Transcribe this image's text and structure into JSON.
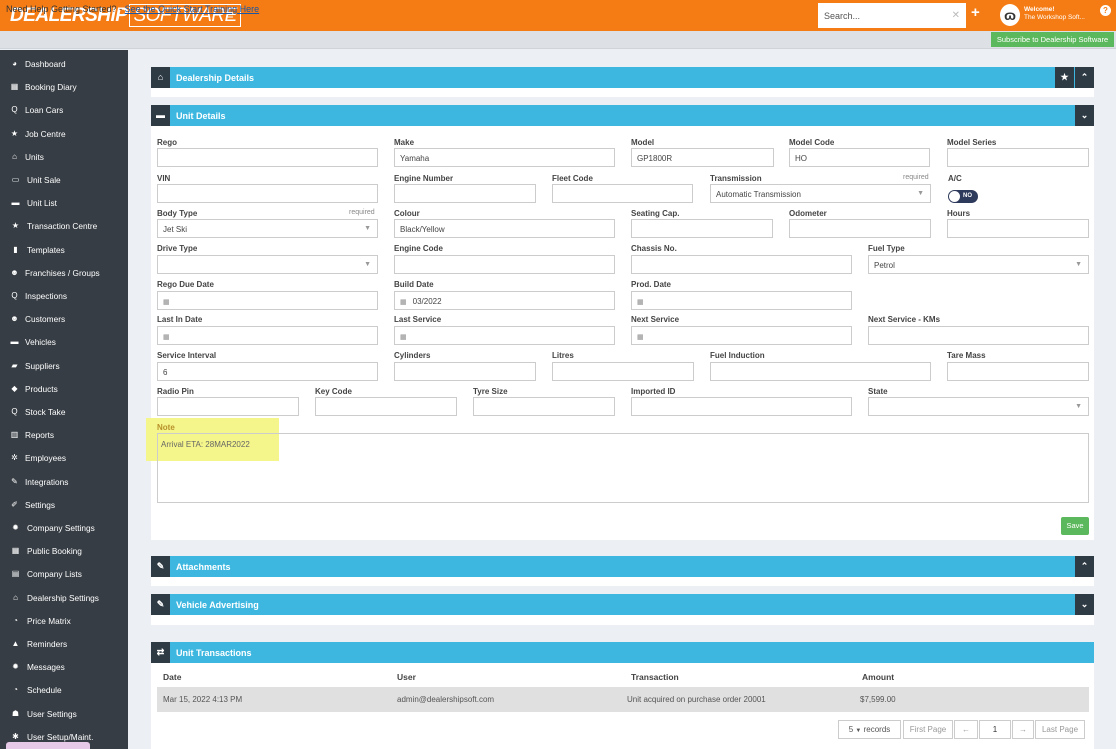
{
  "brand": {
    "bold": "DEALERSHIP",
    "light": "SOFTWARE"
  },
  "header": {
    "menu_icon": "hamburger-icon",
    "search_placeholder": "Search...",
    "welcome_title": "Welcome!",
    "welcome_user": "The Workshop Soft..."
  },
  "helpbar": {
    "text": "Need Help Getting Started? - ",
    "link": "See the Quick Start Training Here",
    "subscribe": "Subscribe to Dealership Software"
  },
  "sidebar": {
    "items": [
      {
        "label": "Dashboard",
        "icon": "dashboard-icon",
        "glyph": "◕"
      },
      {
        "label": "Booking Diary",
        "icon": "calendar-icon",
        "glyph": "▦"
      },
      {
        "label": "Loan Cars",
        "icon": "search-icon",
        "glyph": "Q"
      },
      {
        "label": "Job Centre",
        "icon": "star-icon",
        "glyph": "★"
      },
      {
        "label": "Units",
        "icon": "bank-icon",
        "glyph": "⌂"
      },
      {
        "label": "Unit Sale",
        "icon": "card-icon",
        "glyph": "▭"
      },
      {
        "label": "Unit List",
        "icon": "car-icon",
        "glyph": "▬"
      },
      {
        "label": "Transaction Centre",
        "icon": "star-icon",
        "glyph": "★"
      },
      {
        "label": "Templates",
        "icon": "file-icon",
        "glyph": "▮"
      },
      {
        "label": "Franchises / Groups",
        "icon": "users-icon",
        "glyph": "☻"
      },
      {
        "label": "Inspections",
        "icon": "search-icon",
        "glyph": "Q"
      },
      {
        "label": "Customers",
        "icon": "users-icon",
        "glyph": "☻"
      },
      {
        "label": "Vehicles",
        "icon": "car-icon",
        "glyph": "▬"
      },
      {
        "label": "Suppliers",
        "icon": "truck-icon",
        "glyph": "▰"
      },
      {
        "label": "Products",
        "icon": "tag-icon",
        "glyph": "◆"
      },
      {
        "label": "Stock Take",
        "icon": "search-icon",
        "glyph": "Q"
      },
      {
        "label": "Reports",
        "icon": "chart-icon",
        "glyph": "▥"
      },
      {
        "label": "Employees",
        "icon": "cogs-icon",
        "glyph": "✲"
      },
      {
        "label": "Integrations",
        "icon": "plug-icon",
        "glyph": "✎"
      },
      {
        "label": "Settings",
        "icon": "wrench-icon",
        "glyph": "✐"
      },
      {
        "label": "Company Settings",
        "icon": "gear-icon",
        "glyph": "✹"
      },
      {
        "label": "Public Booking",
        "icon": "calendar-icon",
        "glyph": "▦"
      },
      {
        "label": "Company Lists",
        "icon": "list-icon",
        "glyph": "▤"
      },
      {
        "label": "Dealership Settings",
        "icon": "bank-icon",
        "glyph": "⌂"
      },
      {
        "label": "Price Matrix",
        "icon": "clock-icon",
        "glyph": "◔"
      },
      {
        "label": "Reminders",
        "icon": "bell-icon",
        "glyph": "▲"
      },
      {
        "label": "Messages",
        "icon": "gear-icon",
        "glyph": "✹"
      },
      {
        "label": "Schedule",
        "icon": "clock-icon",
        "glyph": "◔"
      },
      {
        "label": "User Settings",
        "icon": "user-icon",
        "glyph": "☗"
      },
      {
        "label": "User Setup/Maint.",
        "icon": "asterisk-icon",
        "glyph": "✱"
      }
    ]
  },
  "panels": {
    "dealership": "Dealership Details",
    "unit": "Unit Details",
    "attachments": "Attachments",
    "advertising": "Vehicle Advertising",
    "transactions": "Unit Transactions"
  },
  "form": {
    "rego": {
      "label": "Rego",
      "value": ""
    },
    "make": {
      "label": "Make",
      "value": "Yamaha"
    },
    "model": {
      "label": "Model",
      "value": "GP1800R"
    },
    "model_code": {
      "label": "Model Code",
      "value": "HO"
    },
    "model_series": {
      "label": "Model Series",
      "value": ""
    },
    "vin": {
      "label": "VIN",
      "value": ""
    },
    "engine_number": {
      "label": "Engine Number",
      "value": ""
    },
    "fleet_code": {
      "label": "Fleet Code",
      "value": ""
    },
    "transmission": {
      "label": "Transmission",
      "required": "required",
      "value": "Automatic Transmission"
    },
    "ac": {
      "label": "A/C",
      "value": "NO"
    },
    "body_type": {
      "label": "Body Type",
      "required": "required",
      "value": "Jet Ski"
    },
    "colour": {
      "label": "Colour",
      "value": "Black/Yellow"
    },
    "seating": {
      "label": "Seating Cap.",
      "value": ""
    },
    "odometer": {
      "label": "Odometer",
      "value": ""
    },
    "hours": {
      "label": "Hours",
      "value": ""
    },
    "drive_type": {
      "label": "Drive Type",
      "value": ""
    },
    "engine_code": {
      "label": "Engine Code",
      "value": ""
    },
    "chassis": {
      "label": "Chassis No.",
      "value": ""
    },
    "fuel_type": {
      "label": "Fuel Type",
      "value": "Petrol"
    },
    "rego_due": {
      "label": "Rego Due Date",
      "value": ""
    },
    "build_date": {
      "label": "Build Date",
      "value": "03/2022"
    },
    "prod_date": {
      "label": "Prod. Date",
      "value": ""
    },
    "last_in": {
      "label": "Last In Date",
      "value": ""
    },
    "last_service": {
      "label": "Last Service",
      "value": ""
    },
    "next_service": {
      "label": "Next Service",
      "value": ""
    },
    "next_service_kms": {
      "label": "Next Service - KMs",
      "value": ""
    },
    "service_interval": {
      "label": "Service Interval",
      "value": "6"
    },
    "cylinders": {
      "label": "Cylinders",
      "value": ""
    },
    "litres": {
      "label": "Litres",
      "value": ""
    },
    "fuel_induction": {
      "label": "Fuel Induction",
      "value": ""
    },
    "tare_mass": {
      "label": "Tare Mass",
      "value": ""
    },
    "radio_pin": {
      "label": "Radio Pin",
      "value": ""
    },
    "key_code": {
      "label": "Key Code",
      "value": ""
    },
    "tyre_size": {
      "label": "Tyre Size",
      "value": ""
    },
    "imported_id": {
      "label": "Imported ID",
      "value": ""
    },
    "state": {
      "label": "State",
      "value": ""
    },
    "note": {
      "label": "Note",
      "value": "Arrival ETA: 28MAR2022"
    },
    "save": "Save"
  },
  "transactions": {
    "headers": [
      "Date",
      "User",
      "Transaction",
      "Amount"
    ],
    "rows": [
      {
        "date": "Mar 15, 2022 4:13 PM",
        "user": "admin@dealershipsoft.com",
        "transaction": "Unit acquired on purchase order 20001",
        "amount": "$7,599.00"
      }
    ]
  },
  "pagination": {
    "per_page": "5",
    "records": "records",
    "first": "First Page",
    "prev": "←",
    "page": "1",
    "next": "→",
    "last": "Last Page"
  },
  "colors": {
    "brand_orange": "#f57c14",
    "panel_blue": "#3db7e0",
    "sidebar": "#363d44",
    "save_green": "#5cb85c"
  }
}
